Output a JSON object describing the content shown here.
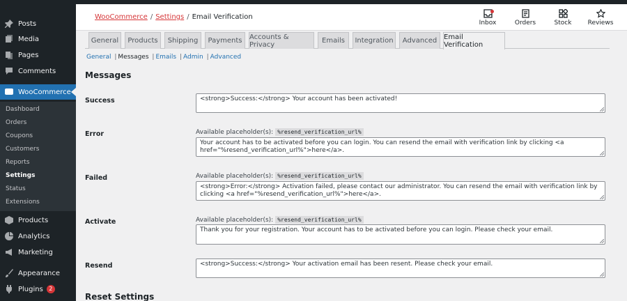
{
  "sidebar": {
    "items": [
      {
        "label": "Posts",
        "icon": "pin-icon"
      },
      {
        "label": "Media",
        "icon": "media-icon"
      },
      {
        "label": "Pages",
        "icon": "pages-icon"
      },
      {
        "label": "Comments",
        "icon": "comments-icon"
      },
      {
        "label": "WooCommerce",
        "icon": "woocommerce-icon"
      },
      {
        "label": "Products",
        "icon": "products-icon"
      },
      {
        "label": "Analytics",
        "icon": "analytics-icon"
      },
      {
        "label": "Marketing",
        "icon": "marketing-icon"
      },
      {
        "label": "Appearance",
        "icon": "appearance-icon"
      },
      {
        "label": "Plugins",
        "icon": "plugins-icon",
        "badge": "2"
      }
    ],
    "submenu": [
      "Dashboard",
      "Orders",
      "Coupons",
      "Customers",
      "Reports",
      "Settings",
      "Status",
      "Extensions"
    ],
    "current_submenu": "Settings"
  },
  "header": {
    "breadcrumb": {
      "first": "WooCommerce",
      "sep": "/",
      "second": "Settings",
      "current": "Email Verification"
    },
    "actions": [
      {
        "label": "Inbox",
        "icon": "inbox-icon"
      },
      {
        "label": "Orders",
        "icon": "orders-icon"
      },
      {
        "label": "Stock",
        "icon": "stock-icon"
      },
      {
        "label": "Reviews",
        "icon": "star-icon"
      }
    ]
  },
  "tabs": [
    "General",
    "Products",
    "Shipping",
    "Payments",
    "Accounts & Privacy",
    "Emails",
    "Integration",
    "Advanced",
    "Email Verification"
  ],
  "active_tab": "Email Verification",
  "subnav": {
    "general": "General",
    "messages": "Messages",
    "emails": "Emails",
    "admin": "Admin",
    "advanced": "Advanced",
    "sep": "|"
  },
  "sections": {
    "messages_title": "Messages",
    "reset_title": "Reset Settings"
  },
  "placeholder_label": "Available placeholder(s):",
  "placeholder_code": "%resend_verification_url%",
  "fields": {
    "success": {
      "label": "Success",
      "value": "<strong>Success:</strong> Your account has been activated!"
    },
    "error": {
      "label": "Error",
      "value": "Your account has to be activated before you can login. You can resend the email with verification link by clicking <a href=\"%resend_verification_url%\">here</a>."
    },
    "failed": {
      "label": "Failed",
      "value": "<strong>Error:</strong> Activation failed, please contact our administrator. You can resend the email with verification link by clicking <a href=\"%resend_verification_url%\">here</a>."
    },
    "activate": {
      "label": "Activate",
      "value": "Thank you for your registration. Your account has to be activated before you can login. Please check your email."
    },
    "resend": {
      "label": "Resend",
      "value": "<strong>Success:</strong> Your activation email has been resent. Please check your email."
    }
  },
  "colors": {
    "sidebar_bg": "#1d2327",
    "accent": "#2271b1",
    "link_red": "#d63638"
  }
}
